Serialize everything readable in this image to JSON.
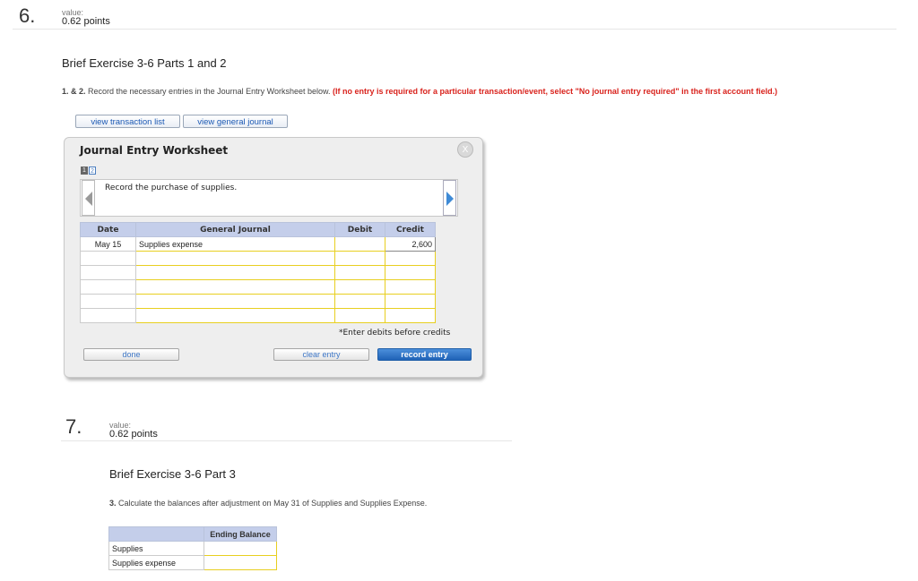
{
  "q6": {
    "number": "6.",
    "value_label": "value:",
    "points": "0.62 points",
    "title": "Brief Exercise 3-6 Parts 1 and 2",
    "instr_prefix": "1. & 2.",
    "instr_text": " Record the necessary entries in the Journal Entry Worksheet below. ",
    "instr_red": "(If no entry is required for a particular transaction/event, select \"No journal entry required\" in the first account field.)",
    "tabs": [
      "view transaction list",
      "view general journal"
    ],
    "worksheet": {
      "title": "Journal Entry Worksheet",
      "close": "X",
      "pages": [
        "1",
        "2"
      ],
      "description": "Record the purchase of supplies.",
      "headers": {
        "date": "Date",
        "account": "General Journal",
        "debit": "Debit",
        "credit": "Credit"
      },
      "rows": [
        {
          "date": "May 15",
          "account": "Supplies expense",
          "debit": "",
          "credit": "2,600"
        },
        {
          "date": "",
          "account": "",
          "debit": "",
          "credit": ""
        },
        {
          "date": "",
          "account": "",
          "debit": "",
          "credit": ""
        },
        {
          "date": "",
          "account": "",
          "debit": "",
          "credit": ""
        },
        {
          "date": "",
          "account": "",
          "debit": "",
          "credit": ""
        },
        {
          "date": "",
          "account": "",
          "debit": "",
          "credit": ""
        }
      ],
      "note": "*Enter debits before credits",
      "buttons": {
        "done": "done",
        "clear": "clear entry",
        "record": "record entry"
      }
    }
  },
  "q7": {
    "number": "7.",
    "value_label": "value:",
    "points": "0.62 points",
    "title": "Brief Exercise 3-6 Part 3",
    "instr_prefix": "3.",
    "instr_text": " Calculate the balances after adjustment on May 31 of Supplies and Supplies Expense.",
    "table": {
      "header": "Ending Balance",
      "rows": [
        {
          "label": "Supplies",
          "value": ""
        },
        {
          "label": "Supplies expense",
          "value": ""
        }
      ]
    }
  },
  "colors": {
    "accent_blue": "#1f62b6",
    "instruction_red": "#d9231d",
    "table_header": "#c4ceea",
    "input_border": "#e8cf20"
  }
}
